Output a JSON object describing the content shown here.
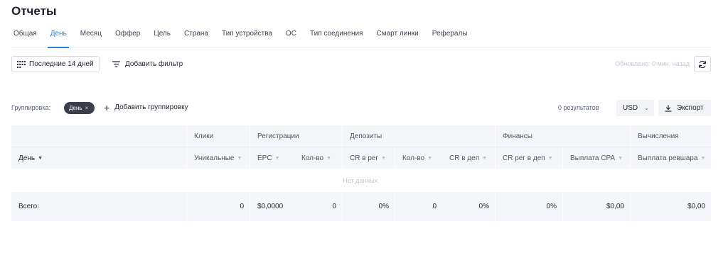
{
  "page": {
    "title": "Отчеты"
  },
  "tabs": [
    {
      "label": "Общая",
      "active": false
    },
    {
      "label": "День",
      "active": true
    },
    {
      "label": "Месяц",
      "active": false
    },
    {
      "label": "Оффер",
      "active": false
    },
    {
      "label": "Цель",
      "active": false
    },
    {
      "label": "Страна",
      "active": false
    },
    {
      "label": "Тип устройства",
      "active": false
    },
    {
      "label": "ОС",
      "active": false
    },
    {
      "label": "Тип соединения",
      "active": false
    },
    {
      "label": "Смарт линки",
      "active": false
    },
    {
      "label": "Рефералы",
      "active": false
    }
  ],
  "toolbar": {
    "period_label": "Последние 14 дней",
    "add_filter_label": "Добавить фильтр",
    "updated_text": "Обновлено: 0 мин. назад"
  },
  "grouping": {
    "label": "Группировка:",
    "chip_label": "День",
    "chip_close": "×",
    "add_label": "Добавить группировку",
    "results_text": "0 результатов",
    "currency": "USD",
    "export_label": "Экспорт"
  },
  "table": {
    "groups": {
      "clicks": "Клики",
      "registrations": "Регистрации",
      "deposits": "Депозиты",
      "finance": "Финансы",
      "calculations": "Вычисления"
    },
    "columns": {
      "day": "День",
      "unique": "Уникальные",
      "epc": "EPC",
      "reg_count": "Кол-во",
      "cr_reg": "CR в рег",
      "dep_count": "Кол-во",
      "cr_dep": "CR в деп",
      "cr_reg_dep": "CR рег в деп",
      "payout_cpa": "Выплата CPA",
      "payout_revshare": "Выплата ревшара"
    },
    "empty_text": "Нет данных.",
    "total": {
      "label": "Всего:",
      "unique": "0",
      "epc": "$0,0000",
      "reg_count": "0",
      "cr_reg": "0%",
      "dep_count": "0",
      "cr_dep": "0%",
      "cr_reg_dep": "0%",
      "payout_cpa": "$0,00",
      "payout_revshare": "$0,00"
    }
  },
  "icons": {
    "period": "grid-icon",
    "filter": "filter-lines-icon",
    "refresh": "refresh-icon",
    "export": "download-icon",
    "sort": "caret-down-icon"
  },
  "colors": {
    "accent": "#2f7fd6",
    "chip_bg": "#3a3f4b",
    "header_bg": "#f4f6f9"
  }
}
